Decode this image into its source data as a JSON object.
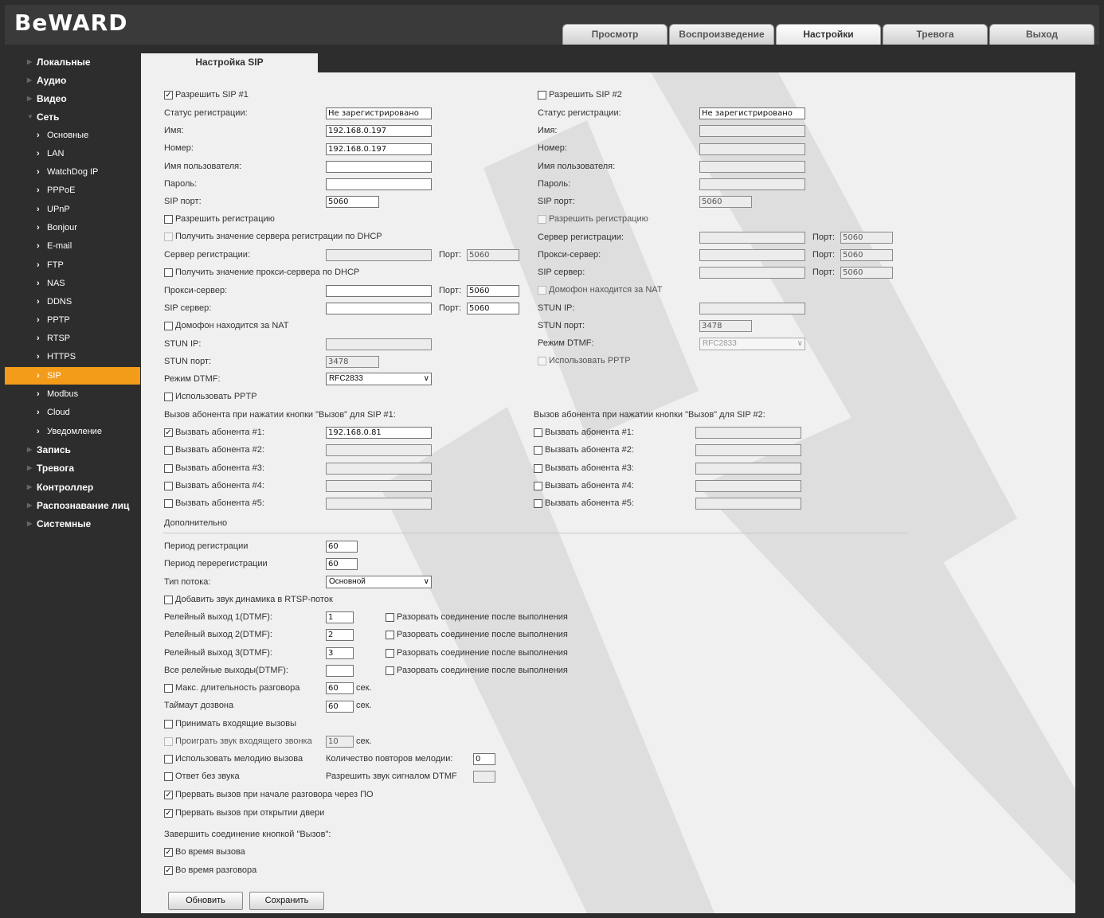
{
  "logo": "BeWARD",
  "tabs": [
    "Просмотр",
    "Воспроизведение",
    "Настройки",
    "Тревога",
    "Выход"
  ],
  "sidebar": {
    "top": [
      "Локальные",
      "Аудио",
      "Видео",
      "Сеть"
    ],
    "network": [
      "Основные",
      "LAN",
      "WatchDog IP",
      "PPPoE",
      "UPnP",
      "Bonjour",
      "E-mail",
      "FTP",
      "NAS",
      "DDNS",
      "PPTP",
      "RTSP",
      "HTTPS",
      "SIP",
      "Modbus",
      "Cloud",
      "Уведомление"
    ],
    "bottom": [
      "Запись",
      "Тревога",
      "Контроллер",
      "Распознавание лиц",
      "Системные"
    ]
  },
  "page_title": "Настройка SIP",
  "sip1": {
    "enable": "Разрешить SIP #1",
    "reg_status_label": "Статус регистрации:",
    "reg_status": "Не зарегистрировано",
    "name_label": "Имя:",
    "name": "192.168.0.197",
    "number_label": "Номер:",
    "number": "192.168.0.197",
    "user_label": "Имя пользователя:",
    "pass_label": "Пароль:",
    "port_label": "SIP порт:",
    "port": "5060",
    "allow_reg": "Разрешить регистрацию",
    "dhcp_reg": "Получить значение сервера регистрации по DHCP",
    "reg_server_label": "Сервер регистрации:",
    "port_short": "Порт:",
    "reg_port": "5060",
    "dhcp_proxy": "Получить значение прокси-сервера по DHCP",
    "proxy_label": "Прокси-сервер:",
    "proxy_port": "5060",
    "sip_server_label": "SIP сервер:",
    "sip_server_port": "5060",
    "nat": "Домофон находится за NAT",
    "stun_ip_label": "STUN IP:",
    "stun_port_label": "STUN порт:",
    "stun_port": "3478",
    "dtmf_label": "Режим DTMF:",
    "dtmf": "RFC2833",
    "pptp": "Использовать PPTP",
    "call_header": "Вызов абонента при нажатии кнопки \"Вызов\" для SIP #1:",
    "calls": [
      "Вызвать абонента #1:",
      "Вызвать абонента #2:",
      "Вызвать абонента #3:",
      "Вызвать абонента #4:",
      "Вызвать абонента #5:"
    ],
    "call1": "192.168.0.81"
  },
  "sip2": {
    "enable": "Разрешить SIP #2",
    "reg_status_label": "Статус регистрации:",
    "reg_status": "Не зарегистрировано",
    "name_label": "Имя:",
    "number_label": "Номер:",
    "user_label": "Имя пользователя:",
    "pass_label": "Пароль:",
    "port_label": "SIP порт:",
    "port": "5060",
    "allow_reg": "Разрешить регистрацию",
    "reg_server_label": "Сервер регистрации:",
    "port_short": "Порт:",
    "reg_port": "5060",
    "proxy_label": "Прокси-сервер:",
    "proxy_port": "5060",
    "sip_server_label": "SIP сервер:",
    "sip_server_port": "5060",
    "nat": "Домофон находится за NAT",
    "stun_ip_label": "STUN IP:",
    "stun_port_label": "STUN порт:",
    "stun_port": "3478",
    "dtmf_label": "Режим DTMF:",
    "dtmf": "RFC2833",
    "pptp": "Использовать PPTP",
    "call_header": "Вызов абонента при нажатии кнопки \"Вызов\" для SIP #2:",
    "calls": [
      "Вызвать абонента #1:",
      "Вызвать абонента #2:",
      "Вызвать абонента #3:",
      "Вызвать абонента #4:",
      "Вызвать абонента #5:"
    ]
  },
  "extra": {
    "header": "Дополнительно",
    "reg_period_label": "Период регистрации",
    "reg_period": "60",
    "rereg_period_label": "Период перерегистрации",
    "rereg_period": "60",
    "stream_label": "Тип потока:",
    "stream": "Основной",
    "rtsp_audio": "Добавить звук динамика в RTSP-поток",
    "relay1_label": "Релейный выход 1(DTMF):",
    "relay1": "1",
    "relay2_label": "Релейный выход 2(DTMF):",
    "relay2": "2",
    "relay3_label": "Релейный выход 3(DTMF):",
    "relay3": "3",
    "relay_all_label": "Все релейные выходы(DTMF):",
    "disconnect": "Разорвать соединение после выполнения",
    "max_talk": "Макс. длительность разговора",
    "max_talk_val": "60",
    "sec": "сек.",
    "dial_timeout_label": "Таймаут дозвона",
    "dial_timeout": "60",
    "accept_incoming": "Принимать входящие вызовы",
    "play_ring": "Проиграть звук входящего звонка",
    "play_ring_val": "10",
    "use_melody": "Использовать мелодию вызова",
    "melody_repeats_label": "Количество повторов мелодии:",
    "melody_repeats": "0",
    "silent_answer": "Ответ без звука",
    "dtmf_sound_label": "Разрешить звук сигналом DTMF",
    "abort_po": "Прервать вызов при начале разговора через ПО",
    "abort_door": "Прервать вызов при открытии двери",
    "end_header": "Завершить соединение кнопкой \"Вызов\":",
    "during_call": "Во время вызова",
    "during_talk": "Во время разговора"
  },
  "buttons": {
    "refresh": "Обновить",
    "save": "Сохранить"
  },
  "colors": {
    "accent": "#f39c1a",
    "sidebar": "#2d2d2d",
    "panel": "#f0f0f0"
  }
}
